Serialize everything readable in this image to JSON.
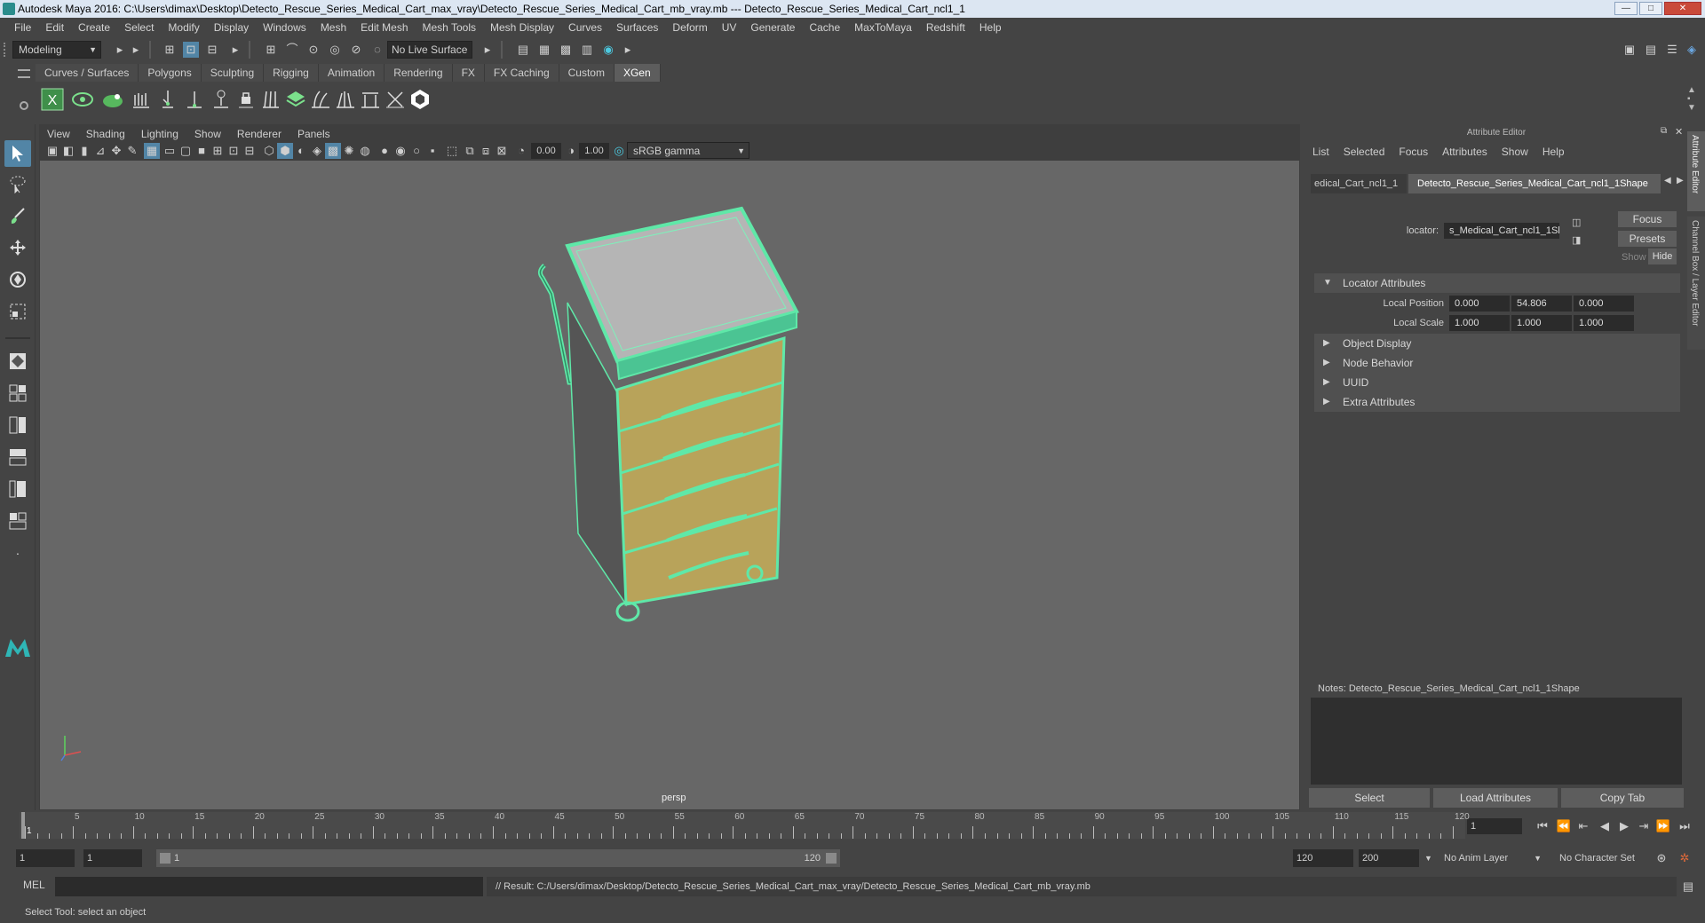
{
  "title_bar": {
    "text": "Autodesk Maya 2016: C:\\Users\\dimax\\Desktop\\Detecto_Rescue_Series_Medical_Cart_max_vray\\Detecto_Rescue_Series_Medical_Cart_mb_vray.mb   ---   Detecto_Rescue_Series_Medical_Cart_ncl1_1",
    "minimize": "—",
    "maximize": "□",
    "close": "✕"
  },
  "menu": [
    "File",
    "Edit",
    "Create",
    "Select",
    "Modify",
    "Display",
    "Windows",
    "Mesh",
    "Edit Mesh",
    "Mesh Tools",
    "Mesh Display",
    "Curves",
    "Surfaces",
    "Deform",
    "UV",
    "Generate",
    "Cache",
    "MaxToMaya",
    "Redshift",
    "Help"
  ],
  "status_line": {
    "mode": "Modeling",
    "live_surface": "No Live Surface"
  },
  "shelf_tabs": [
    "Curves / Surfaces",
    "Polygons",
    "Sculpting",
    "Rigging",
    "Animation",
    "Rendering",
    "FX",
    "FX Caching",
    "Custom",
    "XGen"
  ],
  "shelf_active": "XGen",
  "panel_menu": [
    "View",
    "Shading",
    "Lighting",
    "Show",
    "Renderer",
    "Panels"
  ],
  "panel_toolbar": {
    "exposure": "0.00",
    "gamma": "1.00",
    "color_space": "sRGB gamma"
  },
  "viewport": {
    "camera_label": "persp"
  },
  "attribute_editor": {
    "title": "Attribute Editor",
    "menu": [
      "List",
      "Selected",
      "Focus",
      "Attributes",
      "Show",
      "Help"
    ],
    "tabs": [
      "edical_Cart_ncl1_1",
      "Detecto_Rescue_Series_Medical_Cart_ncl1_1Shape"
    ],
    "type_label": "locator:",
    "node_name": "s_Medical_Cart_ncl1_1Shape",
    "buttons": {
      "focus": "Focus",
      "presets": "Presets",
      "show": "Show",
      "hide": "Hide"
    },
    "sections": {
      "locator_attributes": "Locator Attributes",
      "object_display": "Object Display",
      "node_behavior": "Node Behavior",
      "uuid": "UUID",
      "extra_attributes": "Extra Attributes"
    },
    "local_position": {
      "label": "Local Position",
      "x": "0.000",
      "y": "54.806",
      "z": "0.000"
    },
    "local_scale": {
      "label": "Local Scale",
      "x": "1.000",
      "y": "1.000",
      "z": "1.000"
    },
    "notes": "Notes:  Detecto_Rescue_Series_Medical_Cart_ncl1_1Shape",
    "bottom_buttons": {
      "select": "Select",
      "load": "Load Attributes",
      "copy": "Copy Tab"
    },
    "side_tabs": [
      "Attribute Editor",
      "Channel Box / Layer Editor"
    ]
  },
  "timeline": {
    "ticks": [
      "1",
      "5",
      "10",
      "15",
      "20",
      "25",
      "30",
      "35",
      "40",
      "45",
      "50",
      "55",
      "60",
      "65",
      "70",
      "75",
      "80",
      "85",
      "90",
      "95",
      "100",
      "105",
      "110",
      "115",
      "120"
    ],
    "current_frame": "1"
  },
  "range_slider": {
    "start": "1",
    "inner_start": "1",
    "range_start": "1",
    "range_end": "120",
    "end": "120",
    "max": "200",
    "anim_layer": "No Anim Layer",
    "character_set": "No Character Set"
  },
  "command_line": {
    "language": "MEL",
    "result": "// Result: C:/Users/dimax/Desktop/Detecto_Rescue_Series_Medical_Cart_max_vray/Detecto_Rescue_Series_Medical_Cart_mb_vray.mb"
  },
  "help_line": "Select Tool: select an object",
  "colors": {
    "wireframe": "#5fe8a8",
    "drawer": "#b8a35a",
    "active_tool": "#5285a6"
  }
}
